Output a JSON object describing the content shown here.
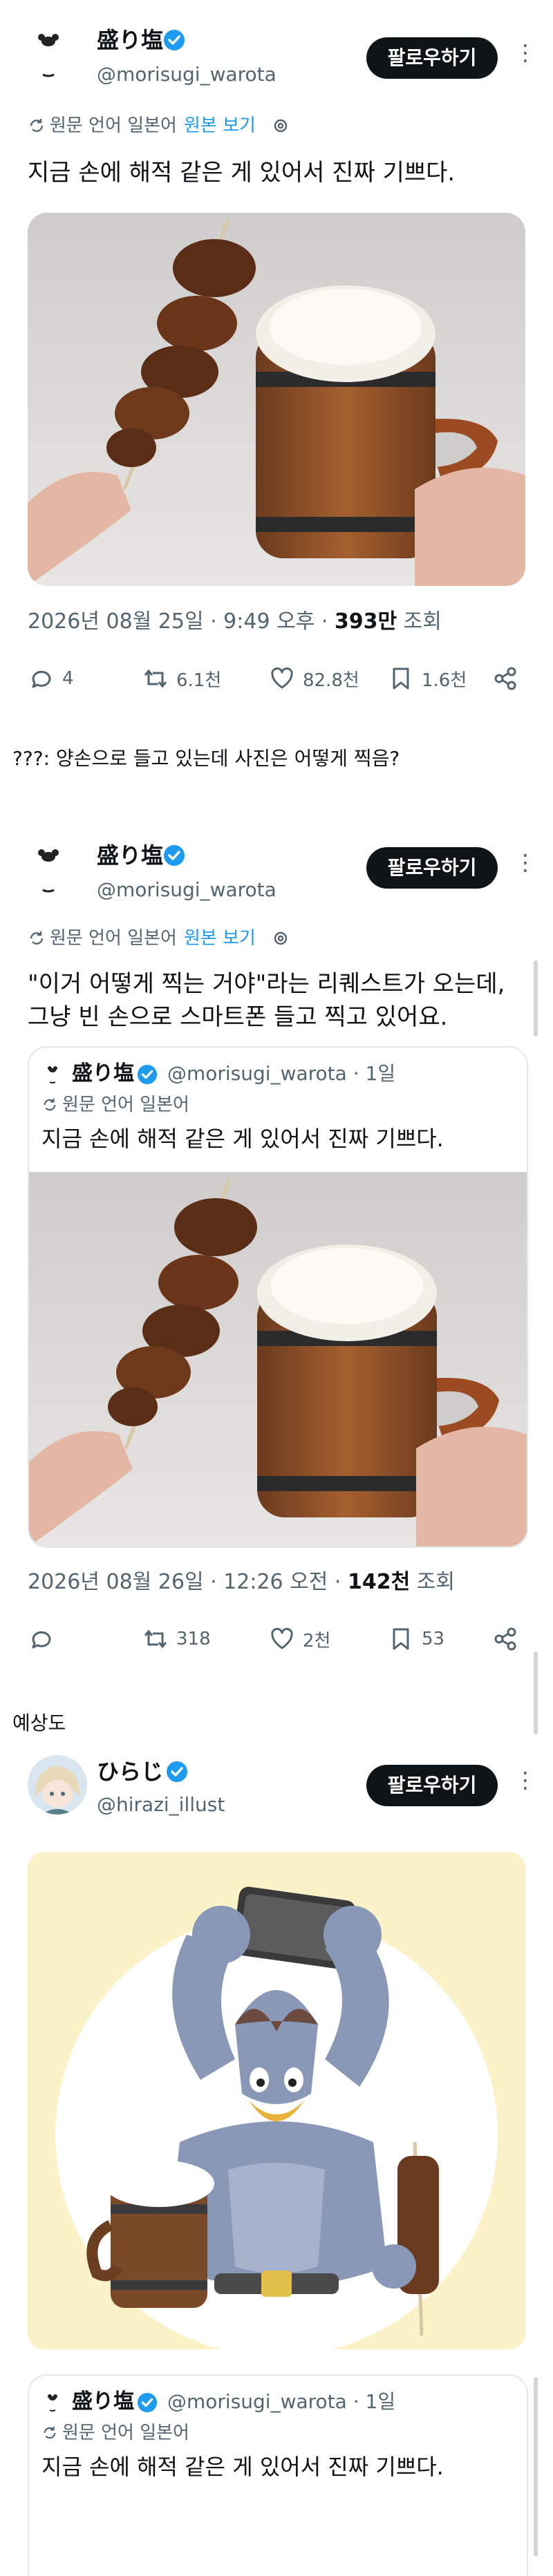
{
  "tweet1": {
    "name": "盛り塩",
    "handle": "@morisugi_warota",
    "follow_label": "팔로우하기",
    "translated_from": "원문 언어 일본어",
    "show_original": "원본 보기",
    "text": "지금 손에 해적 같은 게 있어서 진짜 기쁘다.",
    "timestamp": "2026년 08월 25일 · 9:49 오후 · ",
    "views_count": "393만",
    "views_label": " 조회",
    "replies": "4",
    "retweets": "6.1천",
    "likes": "82.8천",
    "bookmarks": "1.6천"
  },
  "caption1": "???: 양손으로 들고 있는데 사진은 어떻게 찍음?",
  "tweet2": {
    "name": "盛り塩",
    "handle": "@morisugi_warota",
    "follow_label": "팔로우하기",
    "translated_from": "원문 언어 일본어",
    "show_original": "원본 보기",
    "text_line1": "\"이거 어떻게 찍는 거야\"라는 리퀘스트가 오는데,",
    "text_line2": "그냥 빈 손으로 스마트폰 들고 찍고 있어요.",
    "quote": {
      "name": "盛り塩",
      "handle_time": "@morisugi_warota · 1일",
      "translated_from": "원문 언어 일본어",
      "text": "지금 손에 해적 같은 게 있어서 진짜 기쁘다."
    },
    "timestamp": "2026년 08월 26일 · 12:26 오전 · ",
    "views_count": "142천",
    "views_label": " 조회",
    "retweets": "318",
    "likes": "2천",
    "bookmarks": "53"
  },
  "caption2": "예상도",
  "tweet3": {
    "name": "ひらじ",
    "handle": "@hirazi_illust",
    "follow_label": "팔로우하기",
    "quote": {
      "name": "盛り塩",
      "handle_time": "@morisugi_warota · 1일",
      "translated_from": "원문 언어 일본어",
      "text": "지금 손에 해적 같은 게 있어서 진짜 기쁘다."
    }
  },
  "colors": {
    "accent": "#1d9bf0",
    "text": "#0f1419",
    "muted": "#536471",
    "button": "#0f1419"
  }
}
